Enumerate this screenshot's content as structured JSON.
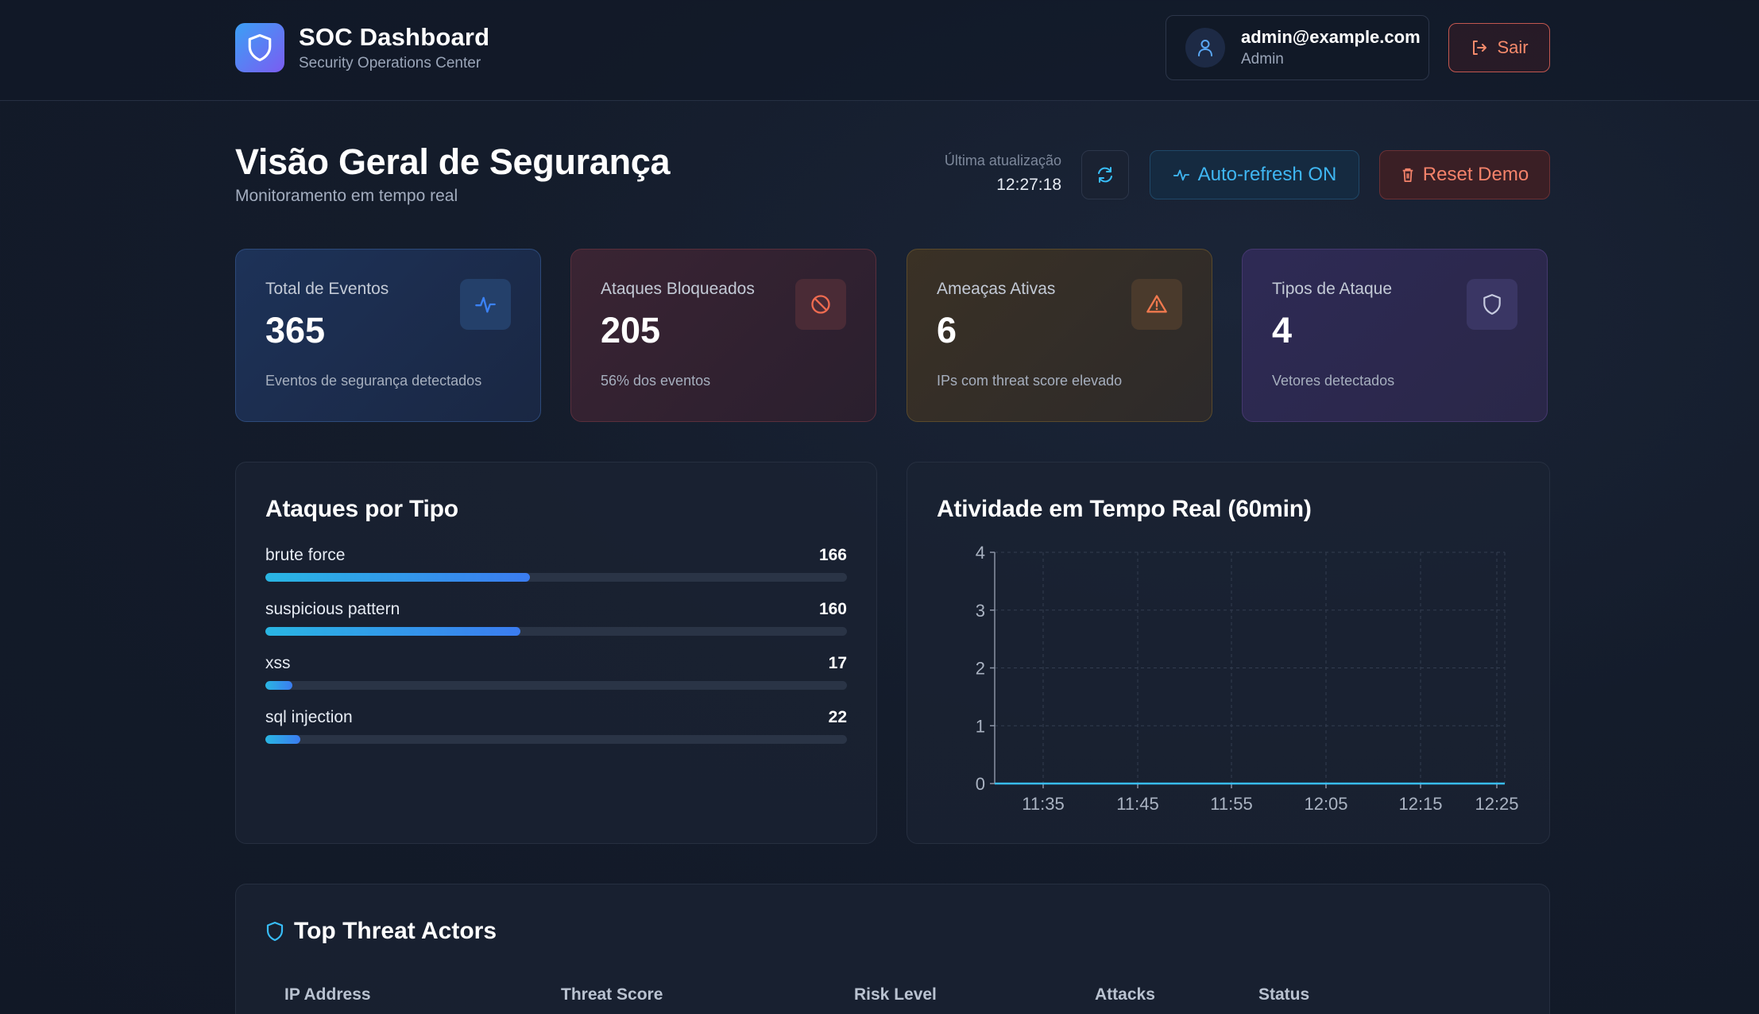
{
  "header": {
    "title": "SOC Dashboard",
    "subtitle": "Security Operations Center",
    "logo_icon": "shield-icon",
    "user_email": "admin@example.com",
    "user_role": "Admin",
    "logout_label": "Sair"
  },
  "page": {
    "title": "Visão Geral de Segurança",
    "subtitle": "Monitoramento em tempo real",
    "last_update_label": "Última atualização",
    "last_update_time": "12:27:18",
    "auto_refresh_label": "Auto-refresh ON",
    "reset_label": "Reset Demo"
  },
  "stats": [
    {
      "label": "Total de Eventos",
      "value": "365",
      "desc": "Eventos de segurança detectados",
      "icon": "activity-icon",
      "color": "#3b82f6"
    },
    {
      "label": "Ataques Bloqueados",
      "value": "205",
      "desc": "56% dos eventos",
      "icon": "ban-icon",
      "color": "#ef6b50"
    },
    {
      "label": "Ameaças Ativas",
      "value": "6",
      "desc": "IPs com threat score elevado",
      "icon": "alert-triangle-icon",
      "color": "#f0794e"
    },
    {
      "label": "Tipos de Ataque",
      "value": "4",
      "desc": "Vetores detectados",
      "icon": "shield-icon",
      "color": "#c7cbe0"
    }
  ],
  "attacks_by_type": {
    "title": "Ataques por Tipo",
    "items": [
      {
        "name": "brute force",
        "count": "166",
        "value": 166
      },
      {
        "name": "suspicious pattern",
        "count": "160",
        "value": 160
      },
      {
        "name": "xss",
        "count": "17",
        "value": 17
      },
      {
        "name": "sql injection",
        "count": "22",
        "value": 22
      }
    ],
    "max": 365
  },
  "realtime": {
    "title": "Atividade em Tempo Real (60min)"
  },
  "chart_data": {
    "type": "line",
    "title": "Atividade em Tempo Real (60min)",
    "xlabel": "",
    "ylabel": "",
    "x_ticks": [
      "11:35",
      "11:45",
      "11:55",
      "12:05",
      "12:15",
      "12:25"
    ],
    "y_ticks": [
      "0",
      "1",
      "2",
      "3",
      "4"
    ],
    "ylim": [
      0,
      4
    ],
    "grid": true,
    "series": [
      {
        "values": [
          0,
          0,
          0,
          0,
          0,
          0
        ]
      }
    ],
    "line_color": "#38bdf8"
  },
  "threat_actors": {
    "title": "Top Threat Actors",
    "columns": [
      "IP Address",
      "Threat Score",
      "Risk Level",
      "Attacks",
      "Status"
    ]
  }
}
